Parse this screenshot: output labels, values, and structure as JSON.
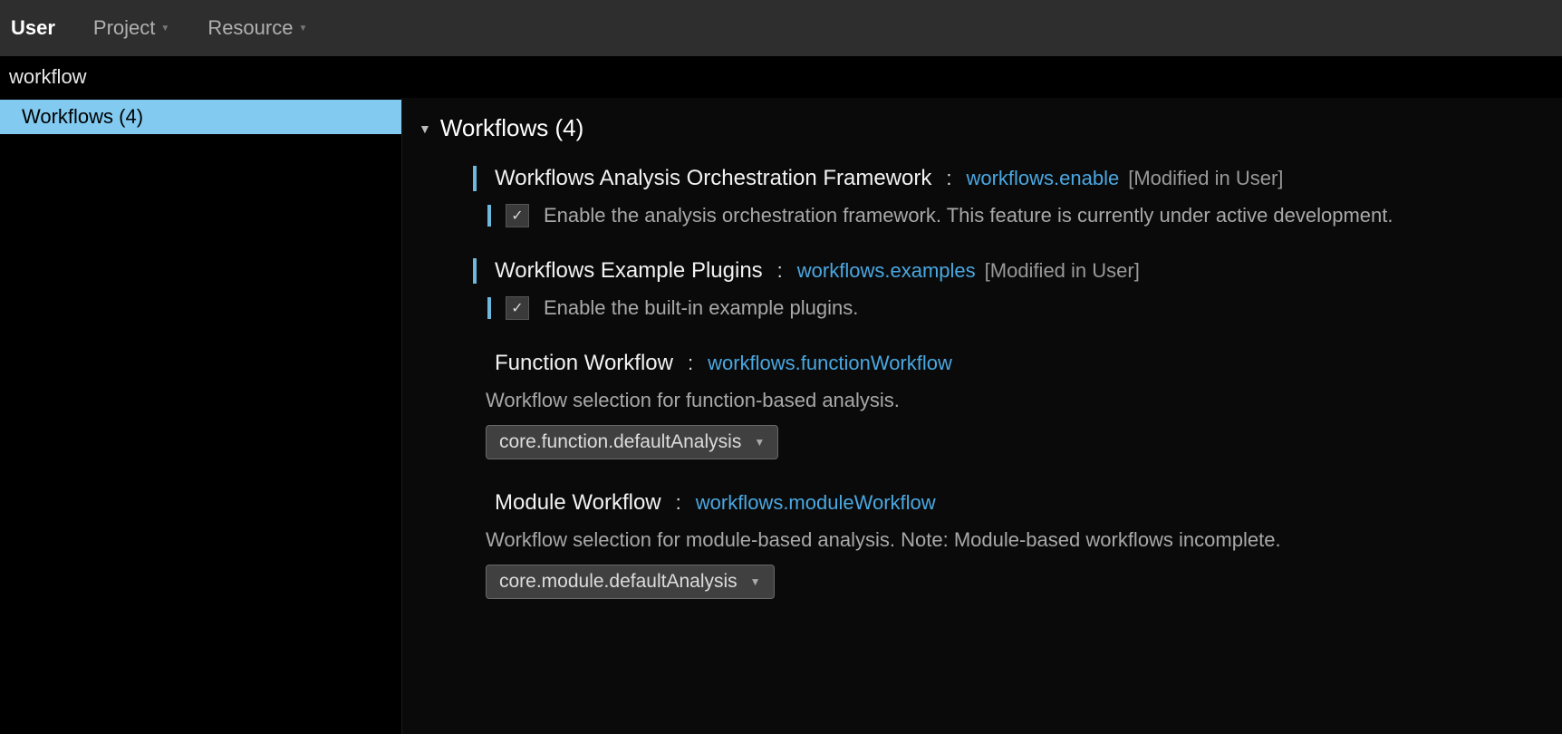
{
  "topbar": {
    "tabs": {
      "user": "User",
      "project": "Project",
      "resource": "Resource"
    }
  },
  "search": {
    "value": "workflow"
  },
  "sidebar": {
    "items": [
      {
        "label": "Workflows (4)"
      }
    ]
  },
  "section": {
    "title": "Workflows (4)"
  },
  "settings": [
    {
      "title": "Workflows Analysis Orchestration Framework",
      "key": "workflows.enable",
      "modified": "[Modified in User]",
      "checkbox": true,
      "desc": "Enable the analysis orchestration framework. This feature is currently under active development."
    },
    {
      "title": "Workflows Example Plugins",
      "key": "workflows.examples",
      "modified": "[Modified in User]",
      "checkbox": true,
      "desc": "Enable the built-in example plugins."
    },
    {
      "title": "Function Workflow",
      "key": "workflows.functionWorkflow",
      "desc": "Workflow selection for function-based analysis.",
      "dropdown": "core.function.defaultAnalysis"
    },
    {
      "title": "Module Workflow",
      "key": "workflows.moduleWorkflow",
      "desc": "Workflow selection for module-based analysis. Note: Module-based workflows incomplete.",
      "dropdown": "core.module.defaultAnalysis"
    }
  ]
}
